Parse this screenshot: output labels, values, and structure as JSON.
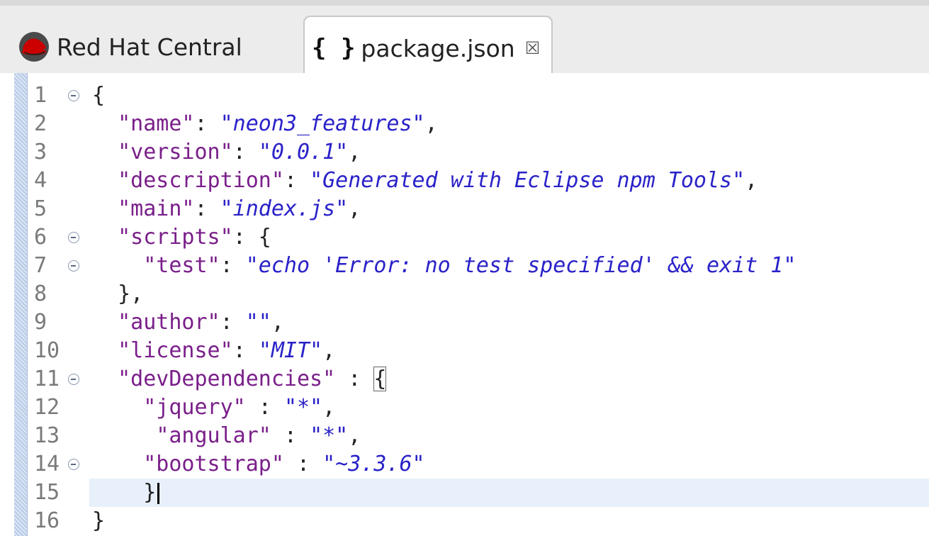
{
  "tabs": [
    {
      "label": "Red Hat Central",
      "icon": "redhat-logo-icon",
      "active": false
    },
    {
      "label": "package.json",
      "icon": "json-braces-icon",
      "icon_text": "{ }",
      "close_glyph": "☒",
      "active": true
    }
  ],
  "editor": {
    "current_line": 15,
    "lines": [
      {
        "n": "1",
        "fold": true,
        "indent": "",
        "parts": [
          {
            "t": "p",
            "s": "{"
          }
        ]
      },
      {
        "n": "2",
        "fold": false,
        "indent": "  ",
        "parts": [
          {
            "t": "k",
            "s": "\"name\""
          },
          {
            "t": "p",
            "s": ": "
          },
          {
            "t": "v",
            "s": "\"neon3_features\""
          },
          {
            "t": "p",
            "s": ","
          }
        ]
      },
      {
        "n": "3",
        "fold": false,
        "indent": "  ",
        "parts": [
          {
            "t": "k",
            "s": "\"version\""
          },
          {
            "t": "p",
            "s": ": "
          },
          {
            "t": "v",
            "s": "\"0.0.1\""
          },
          {
            "t": "p",
            "s": ","
          }
        ]
      },
      {
        "n": "4",
        "fold": false,
        "indent": "  ",
        "parts": [
          {
            "t": "k",
            "s": "\"description\""
          },
          {
            "t": "p",
            "s": ": "
          },
          {
            "t": "v",
            "s": "\"Generated with Eclipse npm Tools\""
          },
          {
            "t": "p",
            "s": ","
          }
        ]
      },
      {
        "n": "5",
        "fold": false,
        "indent": "  ",
        "parts": [
          {
            "t": "k",
            "s": "\"main\""
          },
          {
            "t": "p",
            "s": ": "
          },
          {
            "t": "v",
            "s": "\"index.js\""
          },
          {
            "t": "p",
            "s": ","
          }
        ]
      },
      {
        "n": "6",
        "fold": true,
        "indent": "  ",
        "parts": [
          {
            "t": "k",
            "s": "\"scripts\""
          },
          {
            "t": "p",
            "s": ": {"
          }
        ]
      },
      {
        "n": "7",
        "fold": true,
        "indent": "    ",
        "parts": [
          {
            "t": "k",
            "s": "\"test\""
          },
          {
            "t": "p",
            "s": ": "
          },
          {
            "t": "v",
            "s": "\"echo 'Error: no test specified' && exit 1\""
          }
        ]
      },
      {
        "n": "8",
        "fold": false,
        "indent": "  ",
        "parts": [
          {
            "t": "p",
            "s": "},"
          }
        ]
      },
      {
        "n": "9",
        "fold": false,
        "indent": "  ",
        "parts": [
          {
            "t": "k",
            "s": "\"author\""
          },
          {
            "t": "p",
            "s": ": "
          },
          {
            "t": "v",
            "s": "\"\""
          },
          {
            "t": "p",
            "s": ","
          }
        ]
      },
      {
        "n": "10",
        "fold": false,
        "indent": "  ",
        "parts": [
          {
            "t": "k",
            "s": "\"license\""
          },
          {
            "t": "p",
            "s": ": "
          },
          {
            "t": "v",
            "s": "\"MIT\""
          },
          {
            "t": "p",
            "s": ","
          }
        ]
      },
      {
        "n": "11",
        "fold": true,
        "indent": "  ",
        "parts": [
          {
            "t": "k",
            "s": "\"devDependencies\""
          },
          {
            "t": "p",
            "s": " : "
          },
          {
            "t": "pb",
            "s": "{"
          }
        ]
      },
      {
        "n": "12",
        "fold": false,
        "indent": "    ",
        "parts": [
          {
            "t": "k",
            "s": "\"jquery\""
          },
          {
            "t": "p",
            "s": " : "
          },
          {
            "t": "v",
            "s": "\"*\""
          },
          {
            "t": "p",
            "s": ","
          }
        ]
      },
      {
        "n": "13",
        "fold": false,
        "indent": "     ",
        "parts": [
          {
            "t": "k",
            "s": "\"angular\""
          },
          {
            "t": "p",
            "s": " : "
          },
          {
            "t": "v",
            "s": "\"*\""
          },
          {
            "t": "p",
            "s": ","
          }
        ]
      },
      {
        "n": "14",
        "fold": true,
        "indent": "    ",
        "parts": [
          {
            "t": "k",
            "s": "\"bootstrap\""
          },
          {
            "t": "p",
            "s": " : "
          },
          {
            "t": "v",
            "s": "\"~3.3.6\""
          }
        ]
      },
      {
        "n": "15",
        "fold": false,
        "indent": "    ",
        "parts": [
          {
            "t": "p",
            "s": "}"
          }
        ],
        "caret": true
      },
      {
        "n": "16",
        "fold": false,
        "indent": "",
        "parts": [
          {
            "t": "p",
            "s": "}"
          }
        ]
      }
    ]
  },
  "colors": {
    "key": "#7a1f8a",
    "string_value": "#2a22c8",
    "current_line_highlight": "#e8f0fb",
    "ruler": "#b9cbe6",
    "redhat_red": "#cc0000"
  }
}
